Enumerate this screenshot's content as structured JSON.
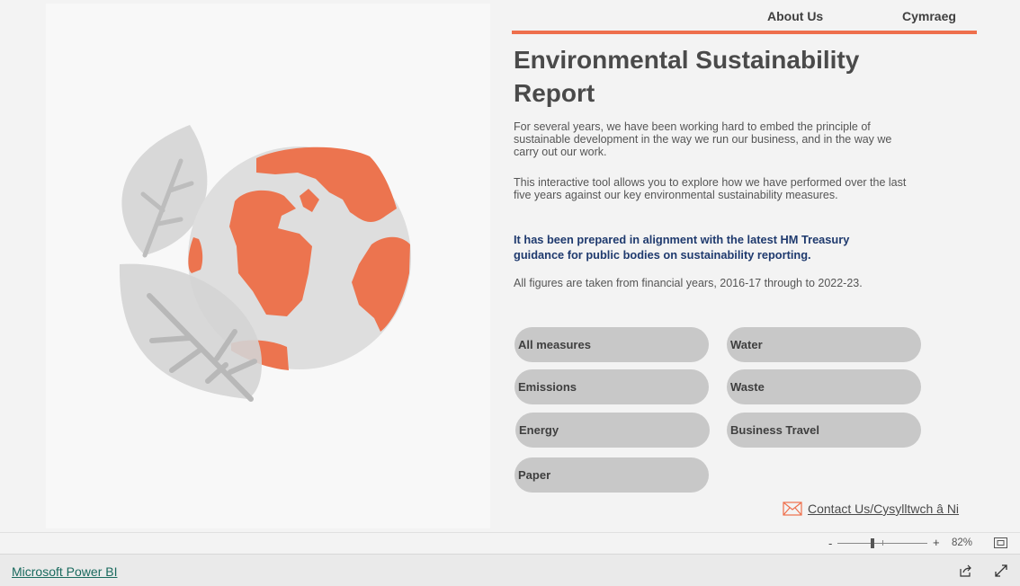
{
  "nav": {
    "about": "About Us",
    "cymraeg": "Cymraeg"
  },
  "report": {
    "title": "Environmental Sustainability Report",
    "intro": "For several years, we have been working hard to embed the principle of sustainable development in the way we run our business, and in the way we carry out our work.",
    "tool": "This interactive tool allows you to explore how we have performed over the last five years against our key environmental sustainability measures.",
    "guidance": "It has been prepared in alignment with the latest HM Treasury guidance for public bodies on sustainability reporting.",
    "figures": "All figures are taken from financial years, 2016-17 through to 2022-23."
  },
  "buttons": {
    "all": "All measures",
    "water": "Water",
    "emissions": "Emissions",
    "waste": "Waste",
    "energy": "Energy",
    "travel": "Business Travel",
    "paper": "Paper"
  },
  "contact": {
    "label": "Contact Us/Cysylltwch â Ni",
    "icon": "mail-icon"
  },
  "statusbar": {
    "zoom_minus": "-",
    "zoom_plus": "+",
    "zoom_value": "82%",
    "zoom_level_percent": 82
  },
  "footer": {
    "brand_link": "Microsoft Power BI"
  },
  "colors": {
    "accent": "#ee6f4c",
    "pill": "#c8c8c8",
    "guidance_text": "#1f3a6e",
    "leaf": "#d6d6d6"
  }
}
